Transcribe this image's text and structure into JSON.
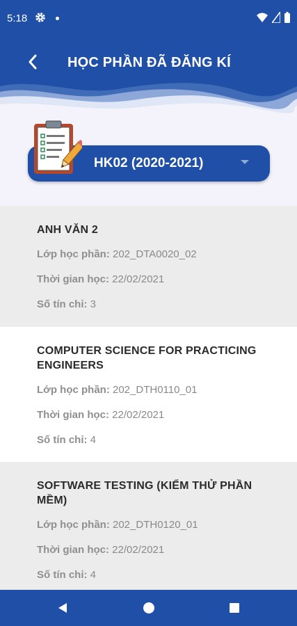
{
  "status_bar": {
    "time": "5:18"
  },
  "header": {
    "title": "HỌC PHẦN ĐÃ ĐĂNG KÍ"
  },
  "semester": {
    "selected": "HK02 (2020-2021)"
  },
  "labels": {
    "class": "Lớp học phần:",
    "time": "Thời gian học:",
    "credits": "Số tín chỉ:"
  },
  "courses": [
    {
      "name": "ANH VĂN 2",
      "class_code": "202_DTA0020_02",
      "start_date": "22/02/2021",
      "credits": "3"
    },
    {
      "name": "COMPUTER SCIENCE FOR PRACTICING ENGINEERS",
      "class_code": "202_DTH0110_01",
      "start_date": "22/02/2021",
      "credits": "4"
    },
    {
      "name": "SOFTWARE TESTING (KIỂM THỬ PHẦN MỀM)",
      "class_code": "202_DTH0120_01",
      "start_date": "22/02/2021",
      "credits": "4"
    }
  ],
  "colors": {
    "primary": "#1f4fa6",
    "background": "#f4f3fb",
    "row_gray": "#ececec"
  }
}
